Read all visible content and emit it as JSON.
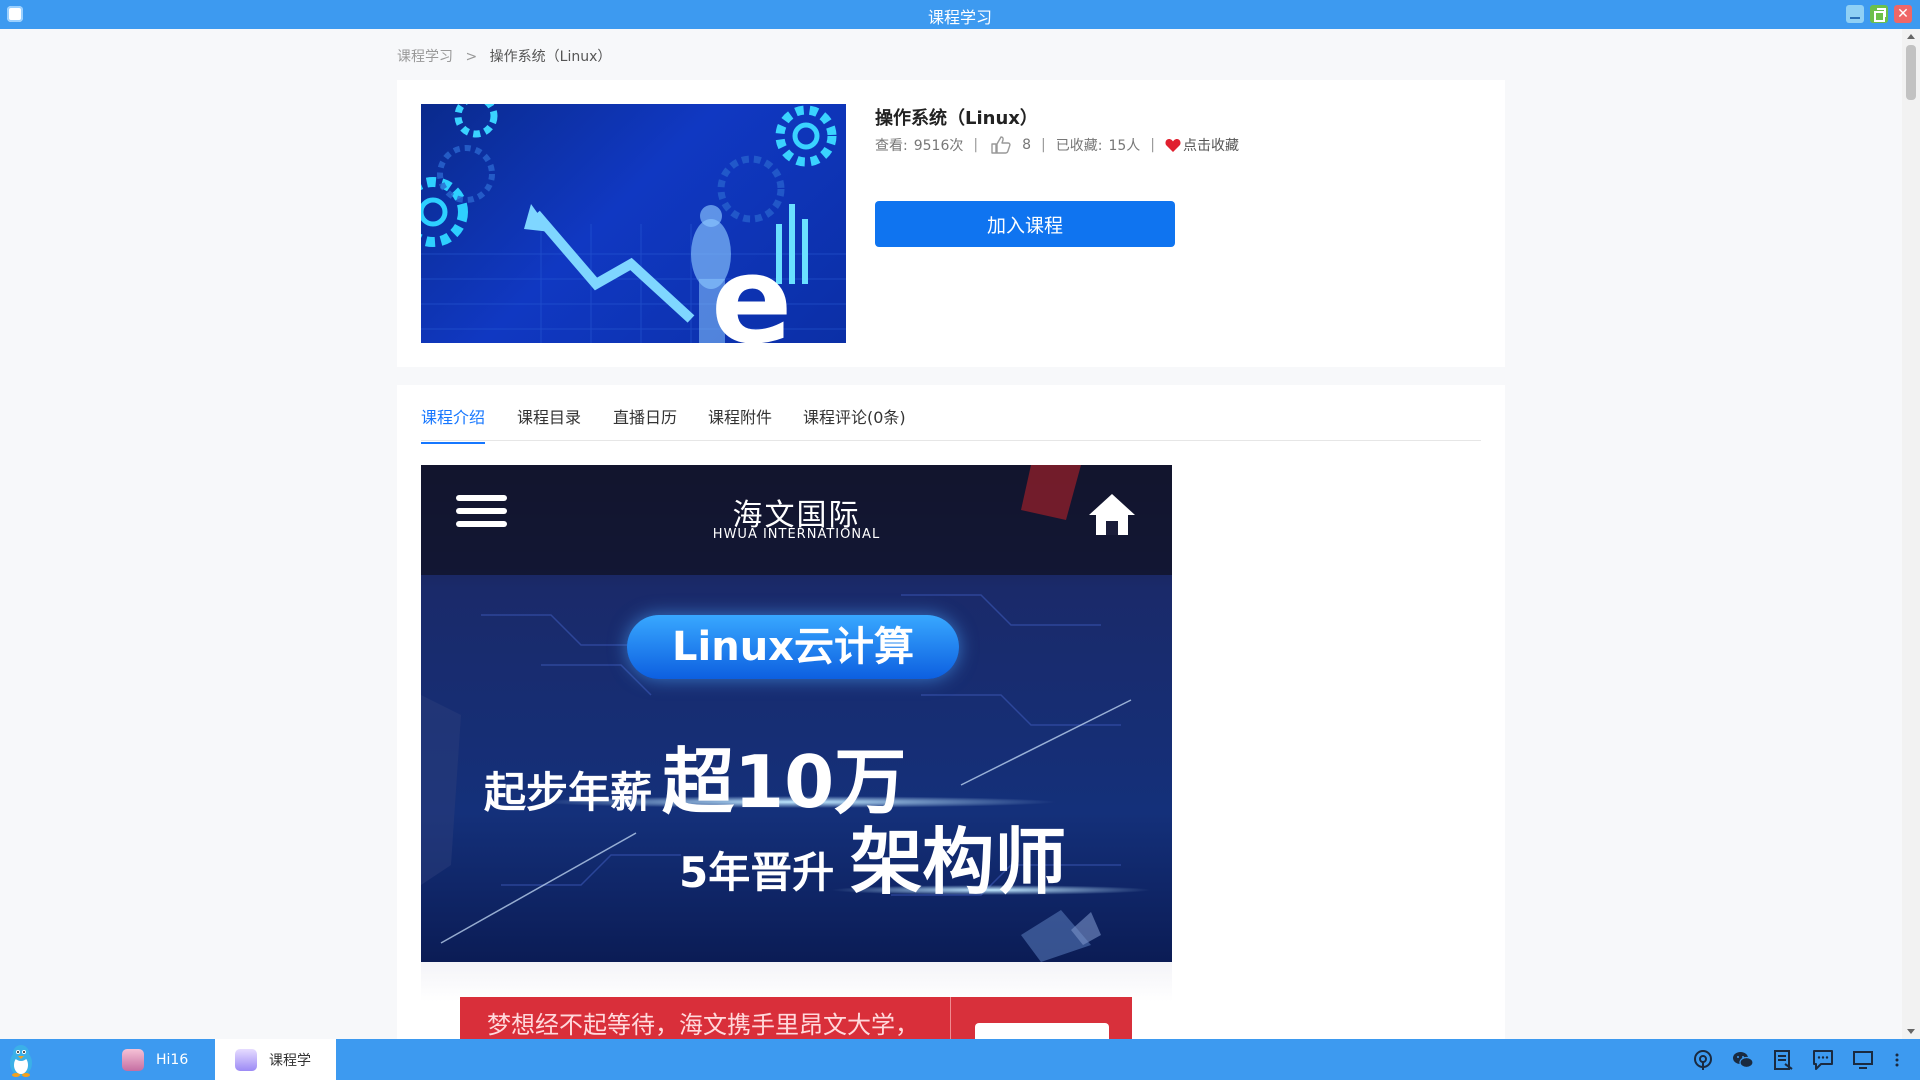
{
  "window": {
    "title": "课程学习"
  },
  "breadcrumb": {
    "root": "课程学习",
    "separator": ">",
    "current": "操作系统（Linux）"
  },
  "course": {
    "title": "操作系统（Linux）",
    "views_label": "查看:",
    "views_value": "9516次",
    "likes": "8",
    "favorites_label": "已收藏:",
    "favorites_value": "15人",
    "favorite_action": "点击收藏",
    "join_button": "加入课程"
  },
  "tabs": [
    {
      "label": "课程介绍",
      "active": true
    },
    {
      "label": "课程目录",
      "active": false
    },
    {
      "label": "直播日历",
      "active": false
    },
    {
      "label": "课程附件",
      "active": false
    },
    {
      "label": "课程评论(0条)",
      "active": false
    }
  ],
  "banner": {
    "logo": "海文国际",
    "logo_sub": "HWUA INTERNATIONAL",
    "pill": "Linux云计算",
    "line1_small": "起步年薪",
    "line1_big": "超10万",
    "line2_small": "5年晋升",
    "line2_big": "架构师"
  },
  "banner2": {
    "text": "梦想经不起等待，海文携手里昂文大学，"
  },
  "taskbar": {
    "items": [
      {
        "label": "Hi16",
        "active": false
      },
      {
        "label": "课程学",
        "active": true
      }
    ],
    "tray_icons": [
      "hotspot-icon",
      "wechat-icon",
      "notes-icon",
      "chat-icon",
      "display-icon",
      "more-icon"
    ]
  },
  "colors": {
    "accent": "#1677ff",
    "titlebar": "#3d9af0",
    "join_button": "#0f74f0",
    "heart": "#e0202f"
  }
}
